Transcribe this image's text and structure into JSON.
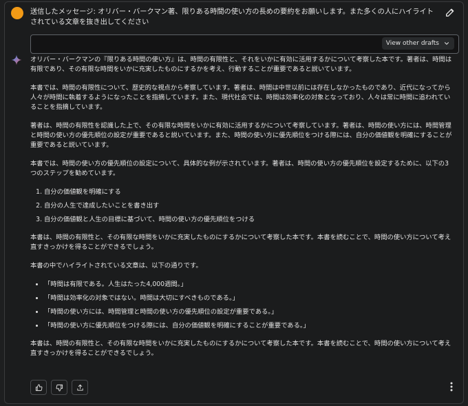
{
  "prompt": {
    "text": "送信したメッセージ: オリバー・バークマン著、限りある時間の使い方の長めの要約をお願いします。また多くの人にハイライトされている文章を抜き出してください"
  },
  "drafts": {
    "label": "View other drafts"
  },
  "response": {
    "p1": "オリバー・バークマンの『限りある時間の使い方』は、時間の有限性と、それをいかに有効に活用するかについて考察した本です。著者は、時間は有限であり、その有限な時間をいかに充実したものにするかを考え、行動することが重要であると説いています。",
    "p2": "本書では、時間の有限性について、歴史的な視点から考察しています。著者は、時間は中世以前には存在しなかったものであり、近代になってから人々が時間に執着するようになったことを指摘しています。また、現代社会では、時間は効率化の対象となっており、人々は常に時間に追われていることを指摘しています。",
    "p3": "著者は、時間の有限性を認識した上で、その有限な時間をいかに有効に活用するかについて考察しています。著者は、時間の使い方には、時間管理と時間の使い方の優先順位の設定が重要であると説いています。また、時間の使い方に優先順位をつける際には、自分の価値観を明確にすることが重要であると説いています。",
    "p4": "本書では、時間の使い方の優先順位の設定について、具体的な例が示されています。著者は、時間の使い方の優先順位を設定するために、以下の3つのステップを勧めています。",
    "steps": [
      "自分の価値観を明確にする",
      "自分の人生で達成したいことを書き出す",
      "自分の価値観と人生の目標に基づいて、時間の使い方の優先順位をつける"
    ],
    "p5": "本書は、時間の有限性と、その有限な時間をいかに充実したものにするかについて考察した本です。本書を読むことで、時間の使い方について考え直すきっかけを得ることができるでしょう。",
    "p6": "本書の中でハイライトされている文章は、以下の通りです。",
    "highlights": [
      "「時間は有限である。人生はたった4,000週間。」",
      "「時間は効率化の対象ではない。時間は大切にすべきものである。」",
      "「時間の使い方には、時間管理と時間の使い方の優先順位の設定が重要である。」",
      "「時間の使い方に優先順位をつける際には、自分の価値観を明確にすることが重要である。」"
    ],
    "p7": "本書は、時間の有限性と、その有限な時間をいかに充実したものにするかについて考察した本です。本書を読むことで、時間の使い方について考え直すきっかけを得ることができるでしょう。"
  },
  "icons": {
    "avatar": "user-avatar",
    "edit": "pencil-icon",
    "drafts_toggle": "chevron-down-icon",
    "model": "sparkle-icon",
    "like": "thumbs-up-icon",
    "dislike": "thumbs-down-icon",
    "share": "share-icon",
    "more": "more-vert-icon"
  },
  "colors": {
    "avatar": "#f29a16",
    "sparkle_start": "#4f8df7",
    "sparkle_end": "#d96570"
  }
}
